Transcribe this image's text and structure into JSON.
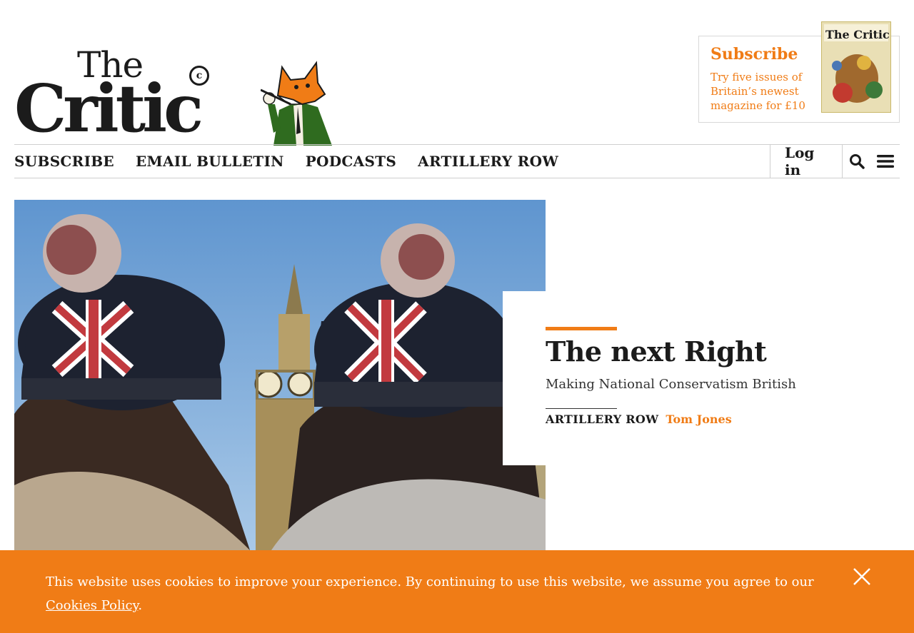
{
  "brand": {
    "logo_the": "The",
    "logo_critic": "Critic",
    "logo_c": "c"
  },
  "promo": {
    "title": "Subscribe",
    "text": "Try five issues of Britain’s newest magazine for £10",
    "cover_brand": "The Critic"
  },
  "nav": {
    "items": [
      "SUBSCRIBE",
      "EMAIL BULLETIN",
      "PODCASTS",
      "ARTILLERY ROW"
    ],
    "login": "Log in",
    "search_icon": "search-icon",
    "menu_icon": "hamburger-menu-icon"
  },
  "hero": {
    "title": "The next Right",
    "subtitle": "Making National Conservatism British",
    "category": "ARTILLERY ROW",
    "author": "Tom Jones"
  },
  "cookie": {
    "text": "This website uses cookies to improve your experience. By continuing to use this website, we assume you agree to our ",
    "link": "Cookies Policy",
    "after": "."
  },
  "colors": {
    "accent": "#f07c16",
    "text": "#1b1b1b"
  }
}
